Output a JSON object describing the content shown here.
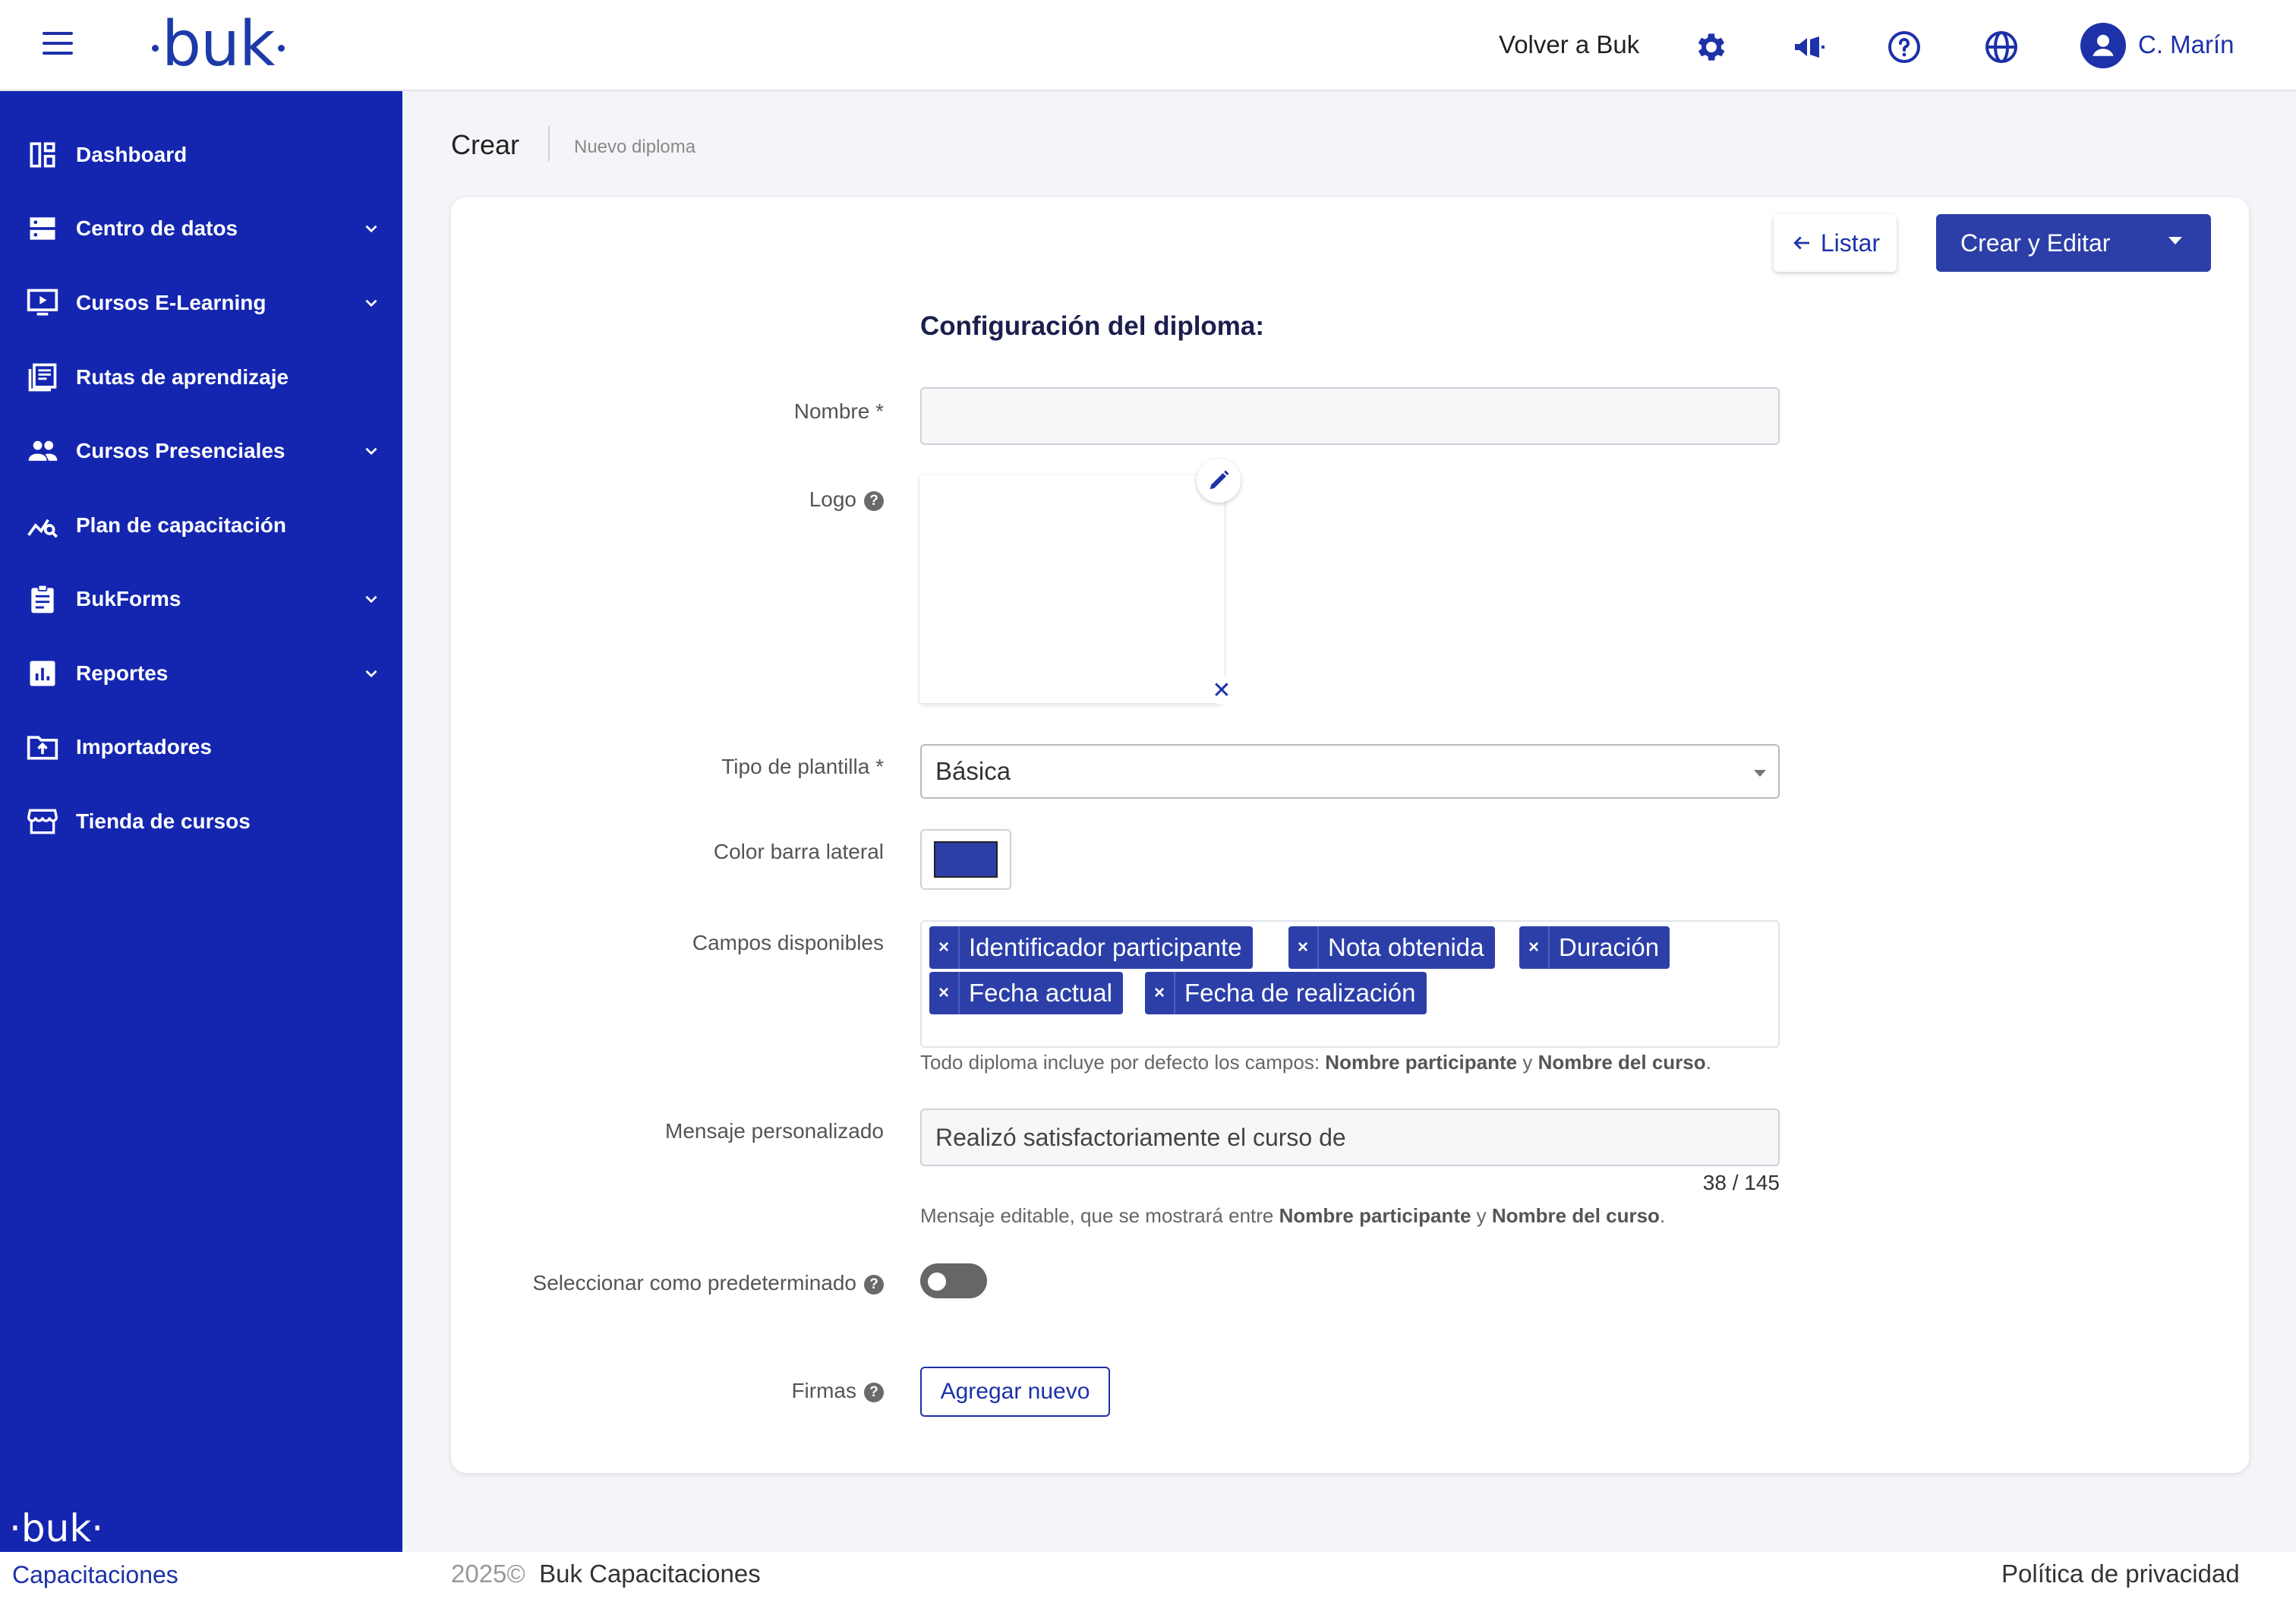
{
  "header": {
    "logo": "buk",
    "volver": "Volver a Buk",
    "icons": [
      "gear-icon",
      "megaphone-icon",
      "help-circle-icon",
      "globe-icon"
    ],
    "user_name": "C. Marín"
  },
  "sidebar": {
    "items": [
      {
        "label": "Dashboard",
        "icon": "dashboard-icon",
        "expandable": false
      },
      {
        "label": "Centro de datos",
        "icon": "database-icon",
        "expandable": true
      },
      {
        "label": "Cursos E-Learning",
        "icon": "monitor-play-icon",
        "expandable": true
      },
      {
        "label": "Rutas de aprendizaje",
        "icon": "book-list-icon",
        "expandable": false
      },
      {
        "label": "Cursos Presenciales",
        "icon": "people-icon",
        "expandable": true
      },
      {
        "label": "Plan de capacitación",
        "icon": "chart-search-icon",
        "expandable": false
      },
      {
        "label": "BukForms",
        "icon": "clipboard-icon",
        "expandable": true
      },
      {
        "label": "Reportes",
        "icon": "bar-chart-icon",
        "expandable": true
      },
      {
        "label": "Importadores",
        "icon": "folder-upload-icon",
        "expandable": false
      },
      {
        "label": "Tienda de cursos",
        "icon": "store-icon",
        "expandable": false
      }
    ],
    "footer_logo": "buk",
    "footer_caption": "Capacitaciones"
  },
  "page": {
    "title": "Crear",
    "subtitle": "Nuevo diploma"
  },
  "actions": {
    "listar": "Listar",
    "crear_editar": "Crear y Editar"
  },
  "form": {
    "section_title": "Configuración del diploma:",
    "nombre_label": "Nombre *",
    "nombre_value": "",
    "logo_label": "Logo",
    "tipo_label": "Tipo de plantilla *",
    "tipo_value": "Básica",
    "color_label": "Color barra lateral",
    "color_value": "#2c3fa8",
    "campos_label": "Campos disponibles",
    "campos_tags": [
      "Identificador participante",
      "Nota obtenida",
      "Duración",
      "Fecha actual",
      "Fecha de realización"
    ],
    "campos_hint_prefix": "Todo diploma incluye por defecto los campos: ",
    "campos_hint_b1": "Nombre participante",
    "campos_hint_and": " y ",
    "campos_hint_b2": "Nombre del curso",
    "campos_hint_end": ".",
    "mensaje_label": "Mensaje personalizado",
    "mensaje_value": "Realizó satisfactoriamente el curso de",
    "mensaje_counter": "38 / 145",
    "mensaje_hint_prefix": "Mensaje editable, que se mostrará entre ",
    "mensaje_hint_b1": "Nombre participante",
    "mensaje_hint_and": " y ",
    "mensaje_hint_b2": "Nombre del curso",
    "mensaje_hint_end": ".",
    "predeterminado_label": "Seleccionar como predeterminado",
    "predeterminado_on": false,
    "firmas_label": "Firmas",
    "agregar_nuevo": "Agregar nuevo"
  },
  "footer": {
    "year": "2025©",
    "company": "Buk Capacitaciones",
    "privacy": "Política de privacidad"
  },
  "colors": {
    "primary": "#1d31a8",
    "sidebar_bg": "#1426b0",
    "tag_bg": "#2c3fa8"
  }
}
